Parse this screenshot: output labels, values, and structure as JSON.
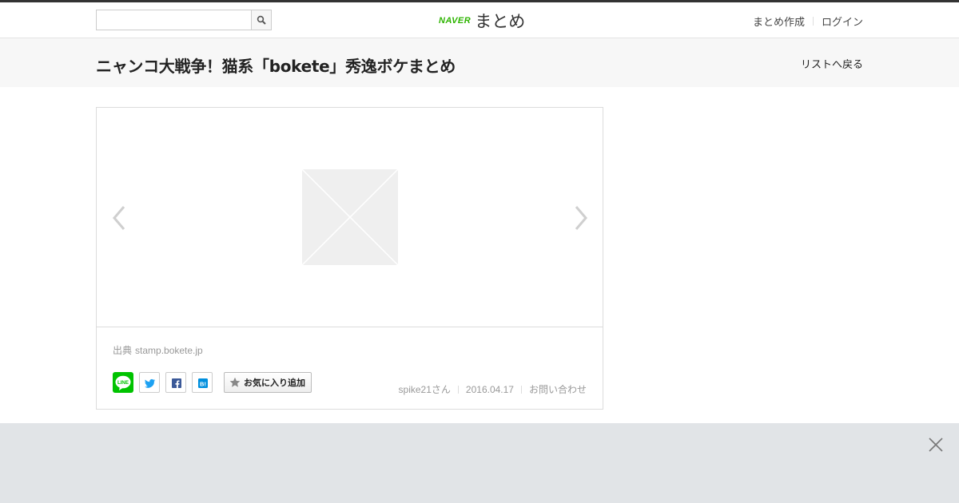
{
  "header": {
    "search": {
      "value": "",
      "placeholder": ""
    },
    "logo": {
      "brand": "NAVER",
      "name": "まとめ"
    },
    "nav": [
      {
        "label": "まとめ作成"
      },
      {
        "label": "ログイン"
      }
    ]
  },
  "title_bar": {
    "title": "ニャンコ大戦争！猫系「bokete」秀逸ボケまとめ",
    "back_label": "リストへ戻る"
  },
  "card": {
    "source_prefix": "出典",
    "source_domain": "stamp.bokete.jp",
    "share_buttons": [
      {
        "name": "line",
        "text": "LINE",
        "color": "#00c300"
      },
      {
        "name": "twitter",
        "color": "#1da1f2"
      },
      {
        "name": "facebook",
        "color": "#3b5998"
      },
      {
        "name": "hatena",
        "text": "B!",
        "color": "#008fde"
      }
    ],
    "favorite_label": "お気に入り追加",
    "author": "spike21さん",
    "date": "2016.04.17",
    "contact_label": "お問い合わせ"
  },
  "colors": {
    "brand_green": "#2db400",
    "ad_background": "#e1e4e7"
  }
}
